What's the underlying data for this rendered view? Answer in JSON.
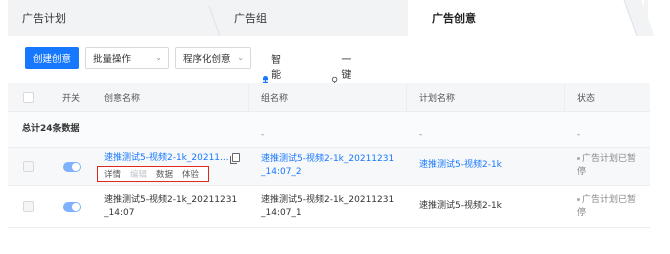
{
  "tabs": {
    "items": [
      "广告计划",
      "广告组"
    ],
    "active": "广告创意"
  },
  "toolbar": {
    "create_label": "创建创意",
    "bulk_label": "批量操作",
    "programmatic_label": "程序化创意",
    "managed_label": "智能托管",
    "clean_label": "一键清理"
  },
  "table": {
    "headers": [
      "开关",
      "创意名称",
      "组名称",
      "计划名称",
      "状态"
    ],
    "total": {
      "label": "总计24条数据",
      "group": "-",
      "plan": "-",
      "status": "-"
    },
    "rows": [
      {
        "creative_name": "速推测试5-视频2-1k_20211...",
        "group_line1": "速推测试5-视频2-1k_20211231",
        "group_line2": "_14:07_2",
        "plan": "速推测试5-视频2-1k",
        "status_line1": "广告计划已暂",
        "status_line2": "停",
        "actions": [
          "详情",
          "编辑",
          "数据",
          "体验"
        ]
      },
      {
        "creative_line1": "速推测试5-视频2-1k_20211231",
        "creative_line2": "_14:07",
        "group_line1": "速推测试5-视频2-1k_20211231",
        "group_line2": "_14:07_1",
        "plan": "速推测试5-视频2-1k",
        "status_line1": "广告计划已暂",
        "status_line2": "停"
      }
    ]
  },
  "colors": {
    "primary": "#1677ff",
    "highlight_box": "#e0281f",
    "toggle_on": "#7fb1ff"
  }
}
